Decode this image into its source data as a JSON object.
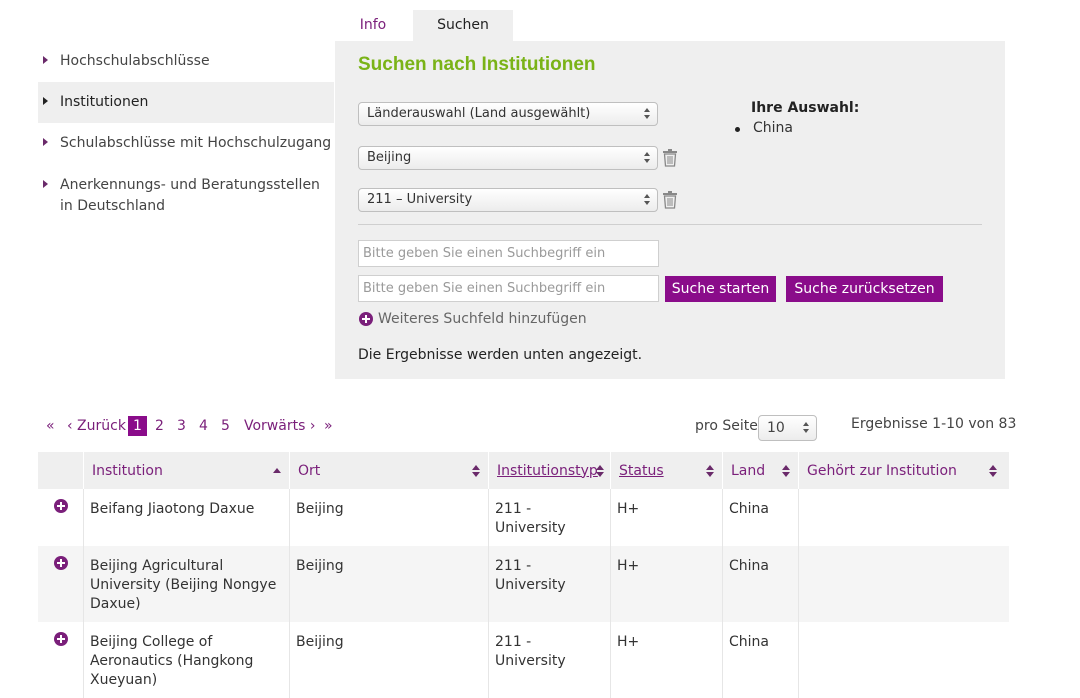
{
  "sidebar": {
    "items": [
      {
        "label": "Hochschulabschlüsse"
      },
      {
        "label": "Institutionen"
      },
      {
        "label": "Schulabschlüsse mit Hochschulzugang"
      },
      {
        "label": "Anerkennungs- und Beratungsstellen in Deutschland"
      }
    ]
  },
  "tabs": {
    "info": "Info",
    "suchen": "Suchen"
  },
  "search": {
    "title": "Suchen nach Institutionen",
    "country_select": "Länderauswahl (Land ausgewählt)",
    "city_select": "Beijing",
    "type_select": "211 – University",
    "selection_title": "Ihre Auswahl:",
    "selection_items": [
      "China"
    ],
    "input_placeholder_1": "Bitte geben Sie einen Suchbegriff ein",
    "input_placeholder_2": "Bitte geben Sie einen Suchbegriff ein",
    "start_button": "Suche starten",
    "reset_button": "Suche zurücksetzen",
    "add_field": "Weiteres Suchfeld hinzufügen",
    "result_note": "Die Ergebnisse werden unten angezeigt."
  },
  "pagination": {
    "first": "«",
    "prev": "‹ Zurück",
    "pages": [
      "1",
      "2",
      "3",
      "4",
      "5"
    ],
    "next": "Vorwärts ›",
    "last": "»",
    "per_page_label": "pro Seite",
    "per_page_value": "10",
    "results": "Ergebnisse 1-10 von 83"
  },
  "table": {
    "headers": [
      "Institution",
      "Ort",
      "Institutionstyp",
      "Status",
      "Land",
      "Gehört zur Institution"
    ],
    "rows": [
      [
        "Beifang Jiaotong Daxue",
        "Beijing",
        "211 - University",
        "H+",
        "China",
        ""
      ],
      [
        "Beijing Agricultural University (Beijing Nongye Daxue)",
        "Beijing",
        "211 - University",
        "H+",
        "China",
        ""
      ],
      [
        "Beijing College of Aeronautics (Hangkong Xueyuan)",
        "Beijing",
        "211 - University",
        "H+",
        "China",
        ""
      ]
    ]
  },
  "colors": {
    "accent": "#8a0c8a",
    "link": "#7a1f7a",
    "title_green": "#7ab317",
    "panel_bg": "#efefef"
  }
}
